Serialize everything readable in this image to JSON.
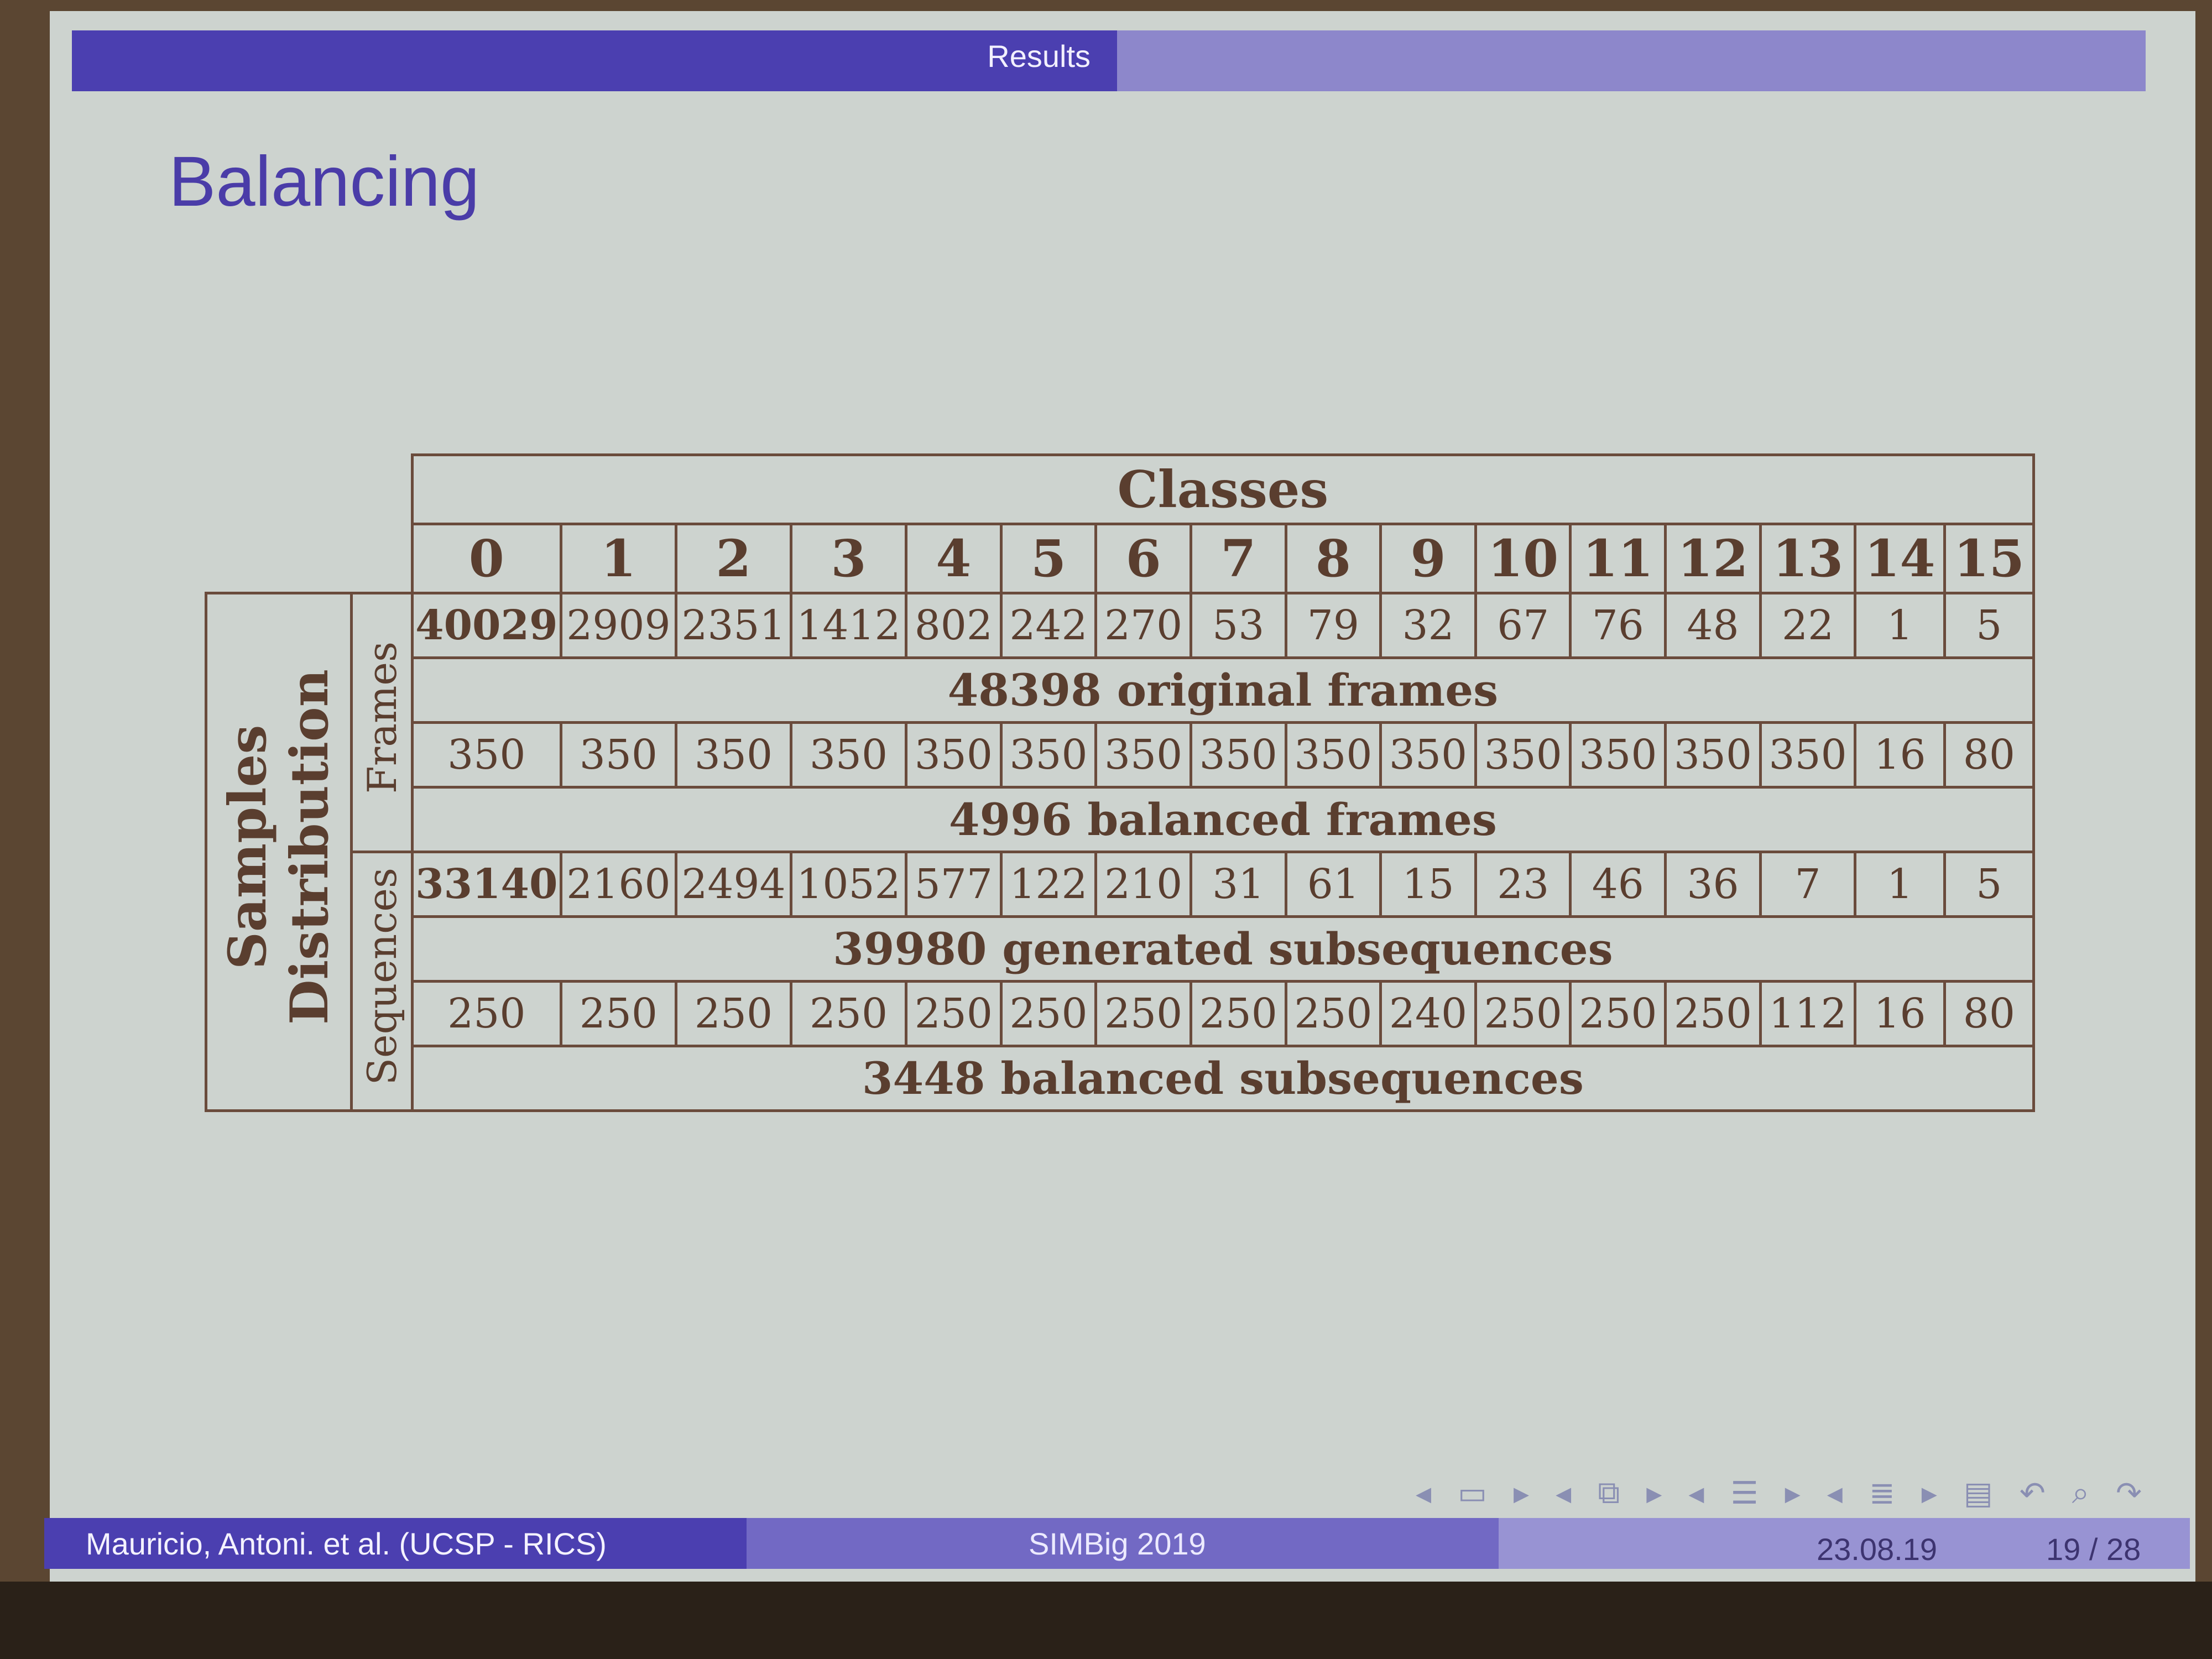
{
  "header": {
    "section": "Results"
  },
  "slide": {
    "title": "Balancing"
  },
  "table": {
    "group_title": "Classes",
    "classes": [
      "0",
      "1",
      "2",
      "3",
      "4",
      "5",
      "6",
      "7",
      "8",
      "9",
      "10",
      "11",
      "12",
      "13",
      "14",
      "15"
    ],
    "row_group_label_line1": "Samples",
    "row_group_label_line2": "Distribution",
    "frames_label": "Frames",
    "sequences_label": "Sequences",
    "frames_original": [
      "40029",
      "2909",
      "2351",
      "1412",
      "802",
      "242",
      "270",
      "53",
      "79",
      "32",
      "67",
      "76",
      "48",
      "22",
      "1",
      "5"
    ],
    "frames_original_total": "48398 original frames",
    "frames_balanced": [
      "350",
      "350",
      "350",
      "350",
      "350",
      "350",
      "350",
      "350",
      "350",
      "350",
      "350",
      "350",
      "350",
      "350",
      "16",
      "80"
    ],
    "frames_balanced_total": "4996 balanced frames",
    "sequences_generated": [
      "33140",
      "2160",
      "2494",
      "1052",
      "577",
      "122",
      "210",
      "31",
      "61",
      "15",
      "23",
      "46",
      "36",
      "7",
      "1",
      "5"
    ],
    "sequences_generated_total": "39980 generated subsequences",
    "sequences_balanced": [
      "250",
      "250",
      "250",
      "250",
      "250",
      "250",
      "250",
      "250",
      "250",
      "240",
      "250",
      "250",
      "250",
      "112",
      "16",
      "80"
    ],
    "sequences_balanced_total": "3448 balanced subsequences"
  },
  "footer": {
    "authors": "Mauricio, Antoni. et al. (UCSP - RICS)",
    "event": "SIMBig 2019",
    "date": "23.08.19",
    "page": "19 / 28"
  },
  "nav": {
    "icons": [
      "nav-prev-arrow",
      "frame-icon",
      "nav-next-arrow",
      "nav-prev-arrow",
      "subsection-icon",
      "nav-next-arrow",
      "nav-prev-arrow",
      "section-icon",
      "nav-next-arrow",
      "nav-prev-arrow",
      "document-icon",
      "nav-next-arrow",
      "appendix-icon",
      "undo-icon",
      "search-icon",
      "redo-icon"
    ]
  }
}
